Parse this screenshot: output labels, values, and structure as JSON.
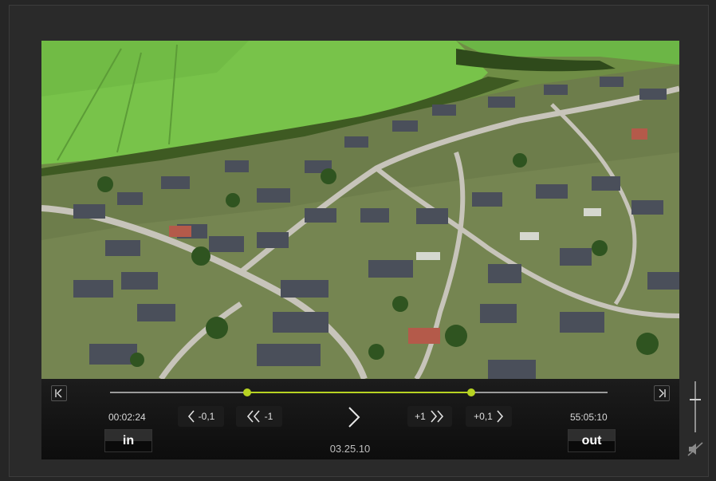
{
  "player": {
    "video_alt": "aerial view of a suburban housing area",
    "timeline": {
      "position_in": 0.276,
      "position_out": 0.726
    },
    "in_time": "00:02:24",
    "out_time": "55:05:10",
    "current_time": "03.25.10",
    "in_label": "in",
    "out_label": "out",
    "step_back_small": "-0,1",
    "step_back_large": "-1",
    "step_forward_large": "+1",
    "step_forward_small": "+0,1",
    "volume_level": 0.34,
    "icons": {
      "go_start": "skip-to-start-icon",
      "go_end": "skip-to-end-icon",
      "play": "play-icon",
      "mute": "mute-icon"
    },
    "colors": {
      "accent": "#b7d322",
      "track": "#9a9a9a"
    }
  }
}
